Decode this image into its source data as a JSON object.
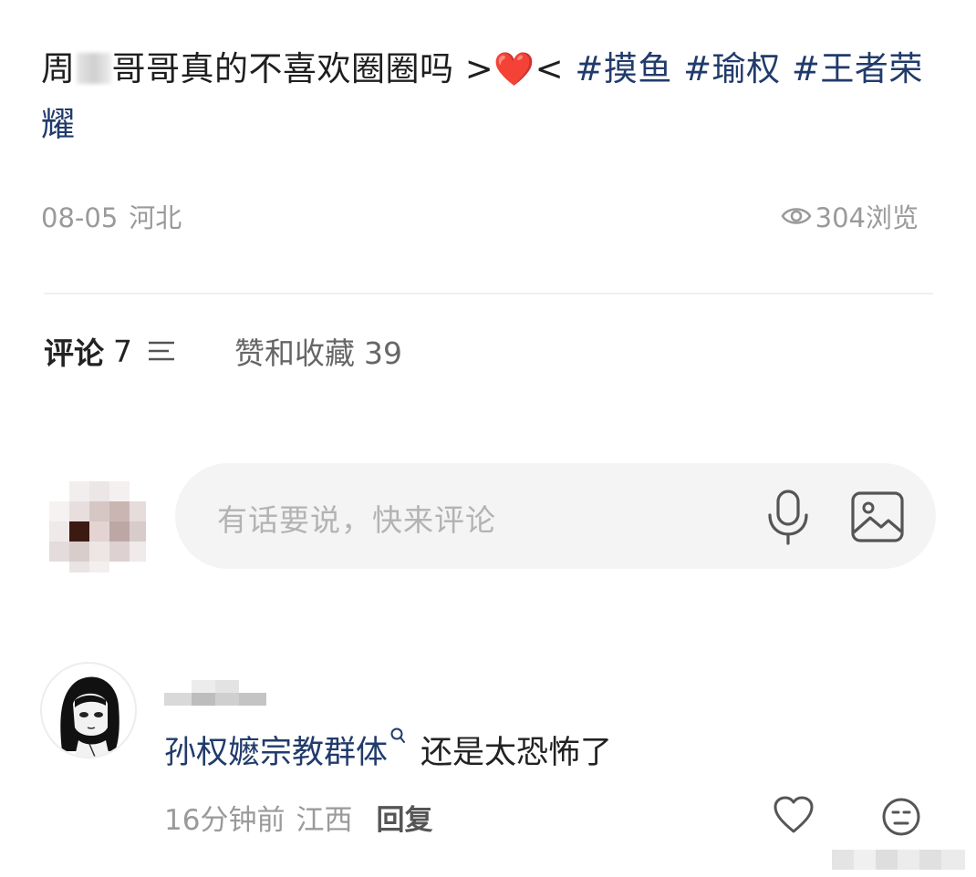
{
  "post": {
    "title_part1": "周",
    "title_part2": "哥哥真的不喜欢圈圈吗 >",
    "heart": "❤️",
    "title_part3": "< ",
    "tags": [
      "#摸鱼",
      "#瑜权",
      "#王者荣耀"
    ],
    "date": "08-05",
    "location": "河北",
    "views": "304浏览"
  },
  "tabs": {
    "comments_label": "评论",
    "comments_count": "7",
    "likes_label": "赞和收藏",
    "likes_count": "39"
  },
  "comment_input": {
    "placeholder": "有话要说，快来评论"
  },
  "comments": [
    {
      "mention": "孙权嬷宗教群体",
      "text": "还是太恐怖了",
      "time": "16分钟前",
      "location": "江西",
      "reply_label": "回复"
    }
  ],
  "icons": {
    "views": "eye-icon",
    "sort": "sort-icon",
    "mic": "microphone-icon",
    "image": "image-icon",
    "like": "heart-icon",
    "emoji": "emoji-icon",
    "search": "search-icon"
  },
  "colors": {
    "tag": "#213b6b",
    "meta": "#9a9a9a",
    "input_bg": "#f4f4f4",
    "heart": "#e8413e"
  }
}
